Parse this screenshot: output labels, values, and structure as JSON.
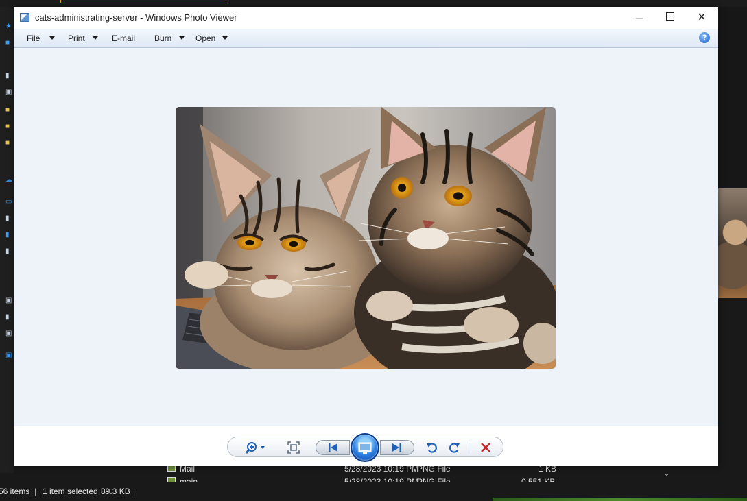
{
  "background_explorer": {
    "files": [
      {
        "name": "Mail",
        "date": "5/28/2023 10:19 PM",
        "type": "PNG File",
        "size": "1 KB"
      },
      {
        "name": "main",
        "date": "5/28/2023 10:19 PM",
        "type": "PNG File",
        "size": "0.551 KB"
      }
    ],
    "status": {
      "item_count": "56 items",
      "selected": "1 item selected",
      "selected_size": "89.3 KB"
    }
  },
  "window": {
    "title": "cats-administrating-server - Windows Photo Viewer",
    "controls": {
      "minimize": "—",
      "close": "✕"
    }
  },
  "menu": [
    {
      "label": "File",
      "has_dropdown": true
    },
    {
      "label": "Print",
      "has_dropdown": true
    },
    {
      "label": "E-mail",
      "has_dropdown": false
    },
    {
      "label": "Burn",
      "has_dropdown": true
    },
    {
      "label": "Open",
      "has_dropdown": true
    }
  ],
  "help_label": "?",
  "photo": {
    "subject": "two tabby cats resting on a wooden desk beside a laptop"
  },
  "toolbar": {
    "buttons": [
      "zoom-icon",
      "actual-size-icon",
      "previous-icon",
      "slideshow-icon",
      "next-icon",
      "rotate-counterclockwise-icon",
      "rotate-clockwise-icon",
      "delete-icon"
    ]
  },
  "colors": {
    "canvas_bg": "#eef3f9",
    "menu_bg": "#e4edf7",
    "accent_blue": "#1f5fb5",
    "delete_red": "#c4262e"
  }
}
